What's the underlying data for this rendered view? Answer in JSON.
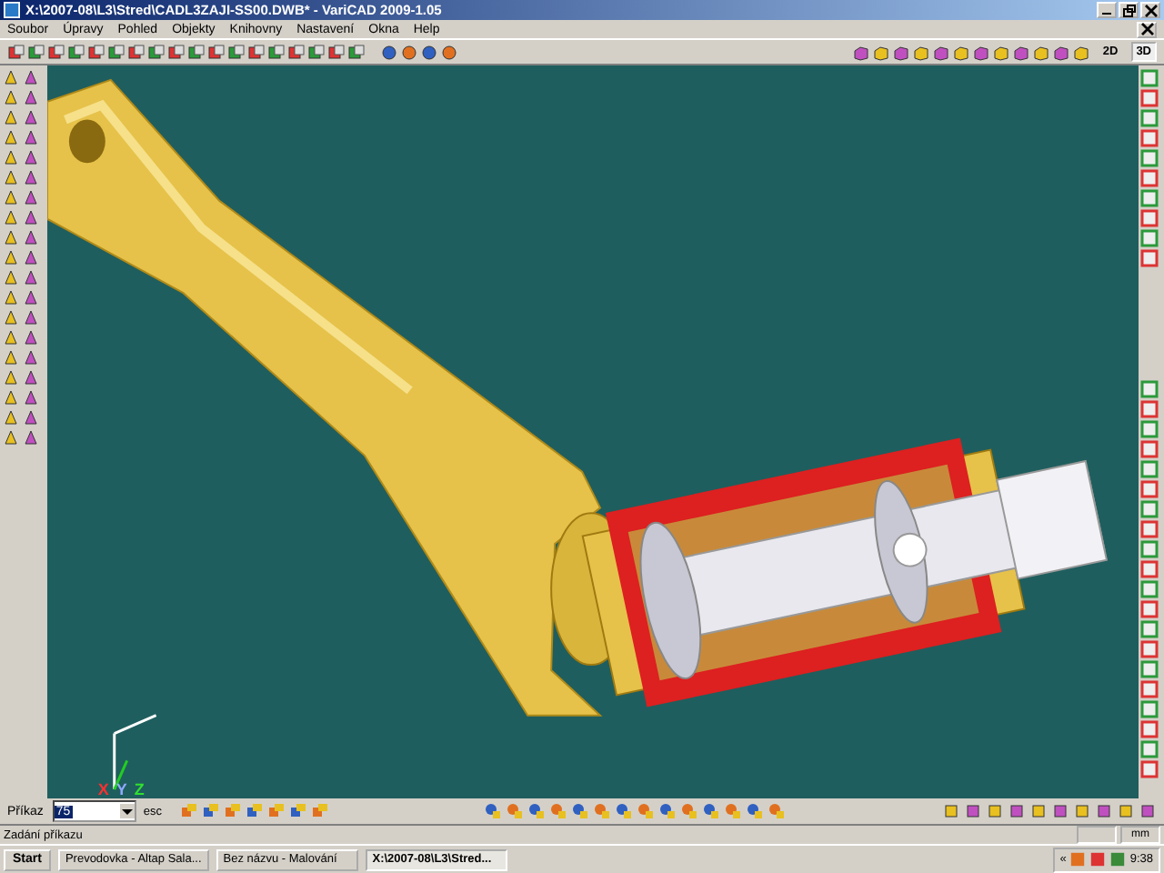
{
  "window": {
    "title": "X:\\2007-08\\L3\\Stred\\CADL3ZAJI-SS00.DWB* - VariCAD 2009-1.05"
  },
  "menu": [
    "Soubor",
    "Úpravy",
    "Pohled",
    "Objekty",
    "Knihovny",
    "Nastavení",
    "Okna",
    "Help"
  ],
  "view_modes": [
    {
      "label": "2D",
      "selected": false
    },
    {
      "label": "3D",
      "selected": true
    }
  ],
  "viewport": {
    "axes": [
      "X",
      "Y",
      "Z"
    ]
  },
  "command_bar": {
    "label": "Příkaz",
    "value": "75",
    "esc": "esc"
  },
  "status_bar": {
    "text": "Zadání příkazu",
    "unit": "mm"
  },
  "taskbar": {
    "start": "Start",
    "tasks": [
      {
        "label": "Prevodovka - Altap Sala...",
        "selected": false
      },
      {
        "label": "Bez názvu - Malování",
        "selected": false
      },
      {
        "label": "X:\\2007-08\\L3\\Stred...",
        "selected": true
      }
    ],
    "tray": "«",
    "clock": "9:38"
  }
}
